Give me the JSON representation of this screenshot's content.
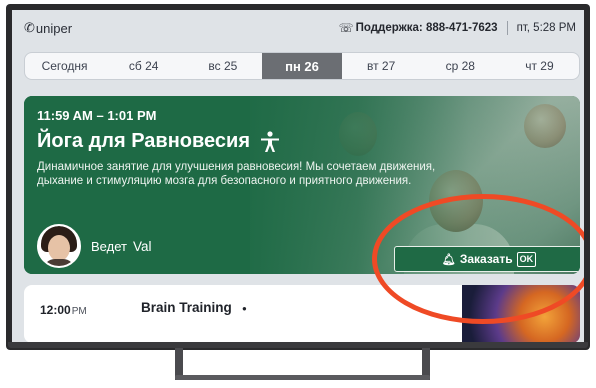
{
  "header": {
    "logo_text": "uniper",
    "support_label": "Поддержка: 888-471-7623",
    "datetime": "пт, 5:28 PM"
  },
  "day_tabs": [
    {
      "label": "Сегодня",
      "active": false
    },
    {
      "label": "сб 24",
      "active": false
    },
    {
      "label": "вс 25",
      "active": false
    },
    {
      "label": "пн 26",
      "active": true
    },
    {
      "label": "вт 27",
      "active": false
    },
    {
      "label": "ср 28",
      "active": false
    },
    {
      "label": "чт 29",
      "active": false
    }
  ],
  "featured": {
    "time_range": "11:59 AM – 1:01 PM",
    "title": "Йога для Равновесия",
    "description": "Динамичное занятие для улучшения равновесия! Мы сочетаем движения, дыхание и стимуляцию мозга для безопасного и приятного движения.",
    "host_label": "Ведет",
    "host_name": "Val",
    "book_label": "Заказать",
    "ok_label": "OK"
  },
  "next_class": {
    "time": "12:00",
    "meridiem": "PM",
    "name": "Brain Training"
  },
  "colors": {
    "accent_green": "#1f6a45",
    "annotation_red": "#ef4a25",
    "active_tab": "#6b6e73"
  }
}
